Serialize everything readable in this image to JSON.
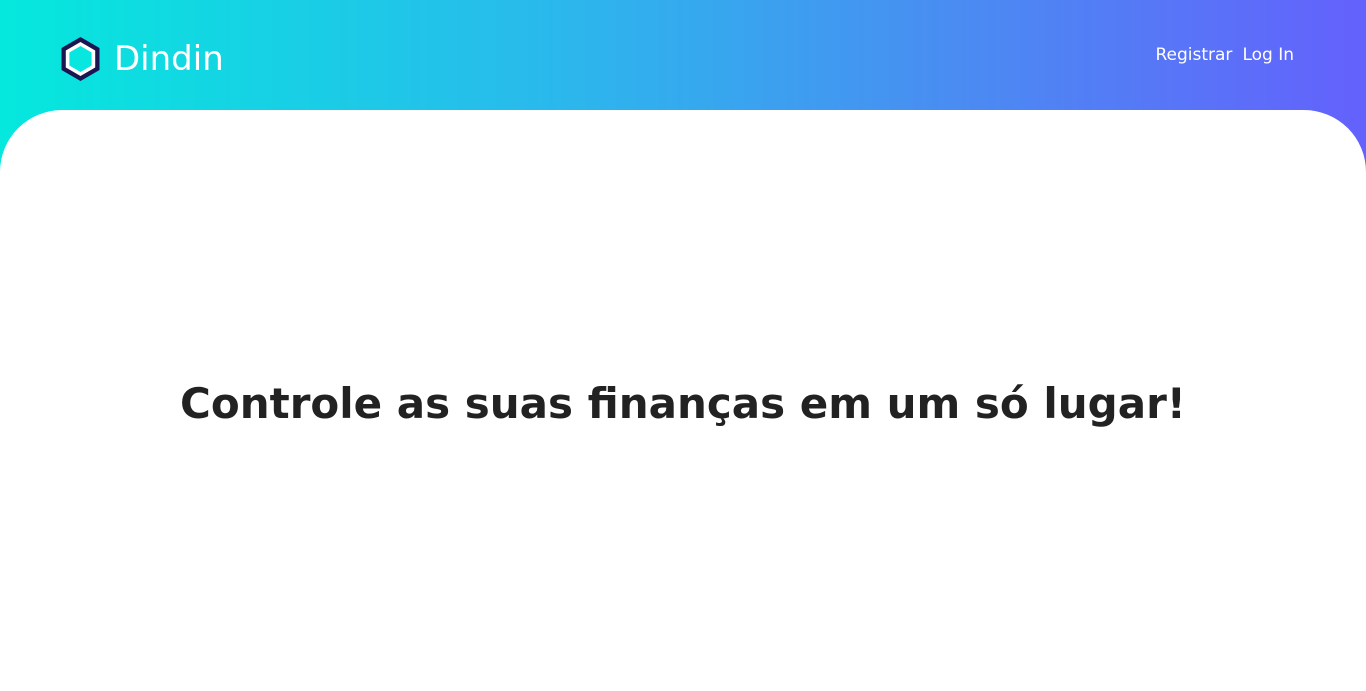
{
  "header": {
    "brand": {
      "name": "Dindin",
      "icon": "hexagon-logo-icon"
    },
    "nav": {
      "register_label": "Registrar",
      "login_label": "Log In"
    }
  },
  "main": {
    "headline": "Controle as suas finanças em um só lugar!"
  },
  "colors": {
    "gradient_start": "#05e8dd",
    "gradient_end": "#6461fc",
    "logo_dark": "#1b1550",
    "logo_fill": "#08e6e0",
    "text_primary": "#222222",
    "nav_text": "#ffffff"
  }
}
